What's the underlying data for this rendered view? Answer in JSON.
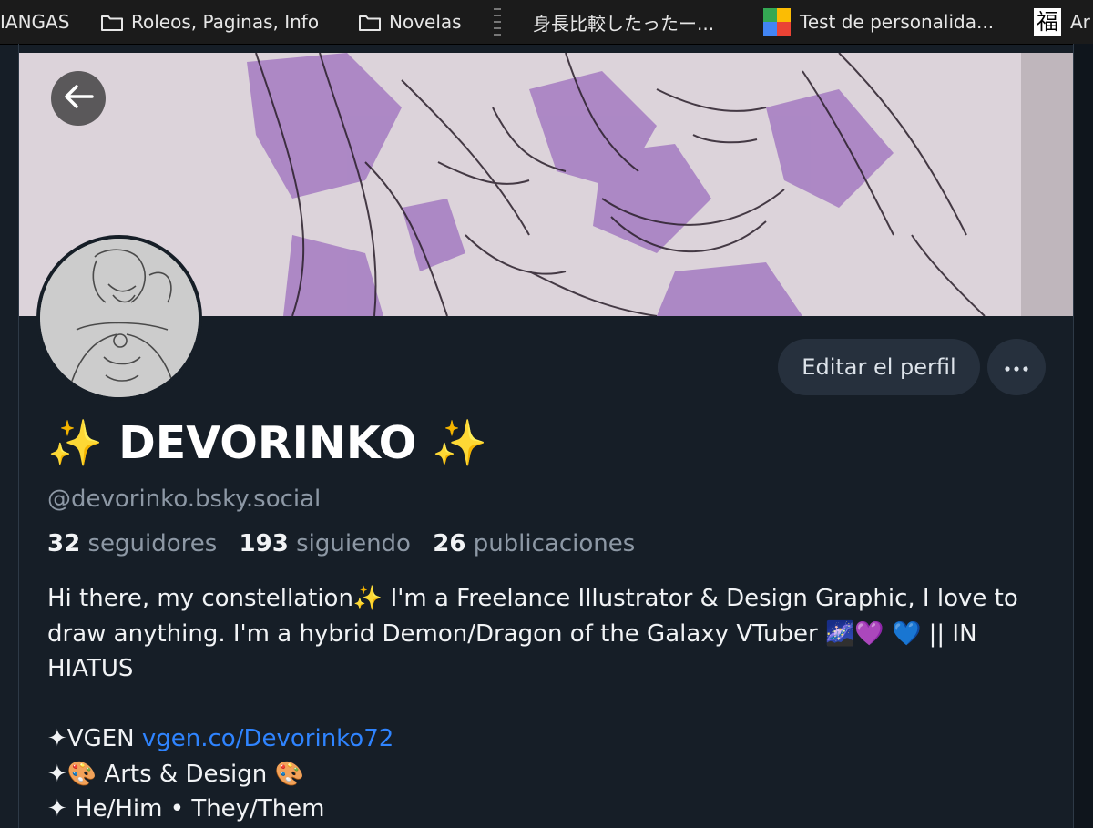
{
  "bookmarks": [
    {
      "label": "IANGAS",
      "icon": "none"
    },
    {
      "label": "Roleos, Paginas, Info",
      "icon": "folder-icon"
    },
    {
      "label": "Novelas",
      "icon": "folder-icon"
    },
    {
      "label": "",
      "icon": "dotted-favicon"
    },
    {
      "label": "身長比較したったー...",
      "icon": "none"
    },
    {
      "label": "Test de personalida...",
      "icon": "google-sheets-favicon"
    },
    {
      "label": "Ar",
      "icon": "kanji-favicon"
    }
  ],
  "kanji_favicon_text": "福",
  "profile": {
    "display_name": "✨ DEVORINKO ✨",
    "handle": "@devorinko.bsky.social",
    "stats": {
      "followers_count": "32",
      "followers_label": "seguidores",
      "following_count": "193",
      "following_label": "siguiendo",
      "posts_count": "26",
      "posts_label": "publicaciones"
    },
    "edit_button_label": "Editar el perfil",
    "more_button_label": "•••",
    "bio": {
      "line1": "Hi there, my constellation✨ I'm a Freelance Illustrator & Design Graphic, I love to draw anything. I'm a hybrid Demon/Dragon of the Galaxy VTuber 🌌💜 💙 || IN HIATUS",
      "vgen_prefix": "✦VGEN ",
      "vgen_link": "vgen.co/Devorinko72",
      "line3": "✦🎨 Arts & Design 🎨",
      "line4": "✦ He/Him • They/Them"
    }
  },
  "colors": {
    "background": "#161e27",
    "button_bg": "#26303d",
    "muted_text": "#8d98a5",
    "link": "#2f84ff",
    "banner_purple": "#9d6fbe"
  }
}
